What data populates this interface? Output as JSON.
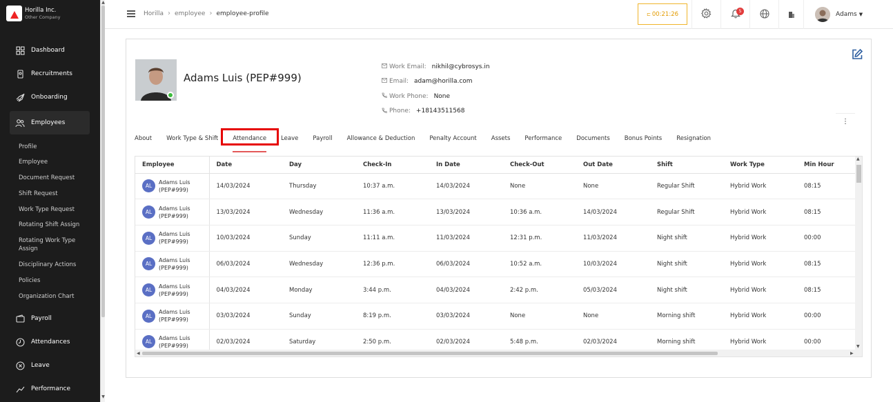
{
  "brand": {
    "name": "Horilla Inc.",
    "subtitle": "Other Company"
  },
  "sidebar": {
    "items": [
      {
        "label": "Dashboard",
        "icon": "dashboard-icon"
      },
      {
        "label": "Recruitments",
        "icon": "recruitment-icon"
      },
      {
        "label": "Onboarding",
        "icon": "rocket-icon"
      },
      {
        "label": "Employees",
        "icon": "users-icon",
        "active": true
      },
      {
        "label": "Payroll",
        "icon": "wallet-icon"
      },
      {
        "label": "Attendances",
        "icon": "clock-icon"
      },
      {
        "label": "Leave",
        "icon": "leave-icon"
      },
      {
        "label": "Performance",
        "icon": "chart-icon"
      }
    ],
    "sub_items": [
      "Profile",
      "Employee",
      "Document Request",
      "Shift Request",
      "Work Type Request",
      "Rotating Shift Assign",
      "Rotating Work Type Assign",
      "Disciplinary Actions",
      "Policies",
      "Organization Chart"
    ]
  },
  "topbar": {
    "breadcrumbs": [
      "Horilla",
      "employee",
      "employee-profile"
    ],
    "timer": "00:21:26",
    "notification_count": "5",
    "user_name": "Adams"
  },
  "profile": {
    "name": "Adams Luis (PEP#999)",
    "work_email_label": "Work Email:",
    "work_email": "nikhil@cybrosys.in",
    "email_label": "Email:",
    "email": "adam@horilla.com",
    "work_phone_label": "Work Phone:",
    "work_phone": "None",
    "phone_label": "Phone:",
    "phone": "+18143511568"
  },
  "tabs": [
    "About",
    "Work Type & Shift",
    "Attendance",
    "Leave",
    "Payroll",
    "Allowance & Deduction",
    "Penalty Account",
    "Assets",
    "Performance",
    "Documents",
    "Bonus Points",
    "Resignation"
  ],
  "selected_tab": "Attendance",
  "table": {
    "columns": [
      "Employee",
      "Date",
      "Day",
      "Check-In",
      "In Date",
      "Check-Out",
      "Out Date",
      "Shift",
      "Work Type",
      "Min Hour"
    ],
    "rows": [
      {
        "initials": "AL",
        "employee": "Adams Luis",
        "code": "(PEP#999)",
        "date": "14/03/2024",
        "day": "Thursday",
        "check_in": "10:37 a.m.",
        "in_date": "14/03/2024",
        "check_out": "None",
        "out_date": "None",
        "shift": "Regular Shift",
        "work_type": "Hybrid Work",
        "min_hour": "08:15"
      },
      {
        "initials": "AL",
        "employee": "Adams Luis",
        "code": "(PEP#999)",
        "date": "13/03/2024",
        "day": "Wednesday",
        "check_in": "11:36 a.m.",
        "in_date": "13/03/2024",
        "check_out": "10:36 a.m.",
        "out_date": "14/03/2024",
        "shift": "Regular Shift",
        "work_type": "Hybrid Work",
        "min_hour": "08:15"
      },
      {
        "initials": "AL",
        "employee": "Adams Luis",
        "code": "(PEP#999)",
        "date": "10/03/2024",
        "day": "Sunday",
        "check_in": "11:11 a.m.",
        "in_date": "11/03/2024",
        "check_out": "12:31 p.m.",
        "out_date": "11/03/2024",
        "shift": "Night shift",
        "work_type": "Hybrid Work",
        "min_hour": "00:00"
      },
      {
        "initials": "AL",
        "employee": "Adams Luis",
        "code": "(PEP#999)",
        "date": "06/03/2024",
        "day": "Wednesday",
        "check_in": "12:36 p.m.",
        "in_date": "06/03/2024",
        "check_out": "10:52 a.m.",
        "out_date": "10/03/2024",
        "shift": "Night shift",
        "work_type": "Hybrid Work",
        "min_hour": "08:15"
      },
      {
        "initials": "AL",
        "employee": "Adams Luis",
        "code": "(PEP#999)",
        "date": "04/03/2024",
        "day": "Monday",
        "check_in": "3:44 p.m.",
        "in_date": "04/03/2024",
        "check_out": "2:42 p.m.",
        "out_date": "05/03/2024",
        "shift": "Night shift",
        "work_type": "Hybrid Work",
        "min_hour": "08:15"
      },
      {
        "initials": "AL",
        "employee": "Adams Luis",
        "code": "(PEP#999)",
        "date": "03/03/2024",
        "day": "Sunday",
        "check_in": "8:19 p.m.",
        "in_date": "03/03/2024",
        "check_out": "None",
        "out_date": "None",
        "shift": "Morning shift",
        "work_type": "Hybrid Work",
        "min_hour": "00:00"
      },
      {
        "initials": "AL",
        "employee": "Adams Luis",
        "code": "(PEP#999)",
        "date": "02/03/2024",
        "day": "Saturday",
        "check_in": "2:50 p.m.",
        "in_date": "02/03/2024",
        "check_out": "5:48 p.m.",
        "out_date": "02/03/2024",
        "shift": "Morning shift",
        "work_type": "Hybrid Work",
        "min_hour": "00:00"
      }
    ]
  },
  "colors": {
    "sidebar_bg": "#1c1c1c",
    "accent": "#e35858",
    "highlight": "#e60000",
    "timer": "#e39b00",
    "avatar": "#5a6fc4",
    "online": "#3dbb3d"
  }
}
